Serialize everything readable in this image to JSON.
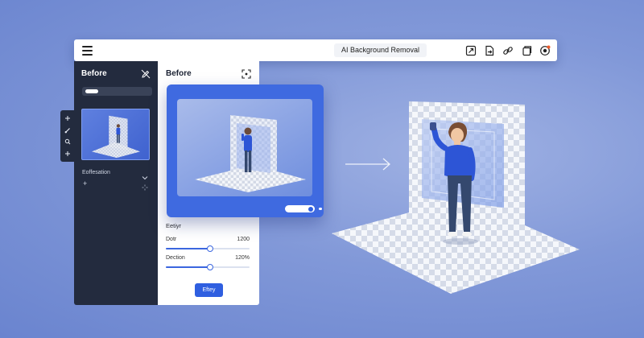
{
  "window": {
    "title": "AI Background Removal"
  },
  "toolbar_icons": [
    "resize-icon",
    "export-icon",
    "link-icon",
    "copy-icon",
    "record-icon"
  ],
  "left_panel": {
    "title": "Before",
    "section_label": "Eoffesation",
    "tool_icons": [
      "plus-icon",
      "brush-icon",
      "search-icon",
      "plus-icon"
    ]
  },
  "mid_panel": {
    "title": "Before",
    "effect_label": "Eetiyr",
    "sliders": [
      {
        "name": "Dotr",
        "value_text": "1200",
        "fraction": 0.53
      },
      {
        "name": "Dection",
        "value_text": "120%",
        "fraction": 0.53
      }
    ],
    "apply_label": "Eftey"
  },
  "colors": {
    "accent": "#2f5fe0",
    "panel_dark": "#232b3e",
    "background": "#8198d8"
  }
}
